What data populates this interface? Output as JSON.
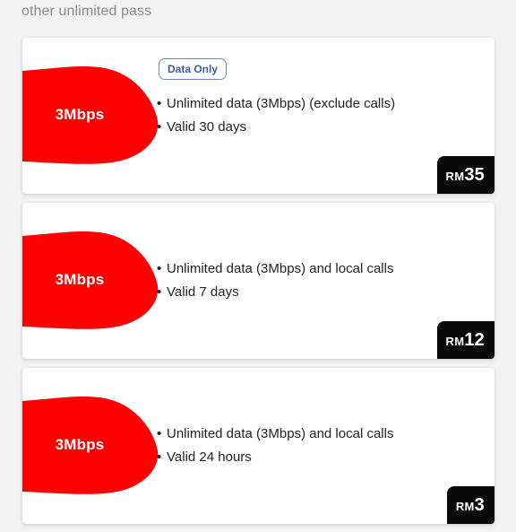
{
  "section_title": "other unlimited pass",
  "colors": {
    "brand_red": "#ff0000",
    "price_bg": "#0a0a0a",
    "badge_border": "#6f88c8"
  },
  "passes": [
    {
      "speed": "3Mbps",
      "badge": "Data Only",
      "features": [
        "Unlimited data (3Mbps) (exclude calls)",
        "Valid 30 days"
      ],
      "currency": "RM",
      "amount": "35"
    },
    {
      "speed": "3Mbps",
      "features": [
        "Unlimited data (3Mbps) and local calls",
        "Valid 7 days"
      ],
      "currency": "RM",
      "amount": "12"
    },
    {
      "speed": "3Mbps",
      "features": [
        "Unlimited data (3Mbps) and local calls",
        "Valid 24 hours"
      ],
      "currency": "RM",
      "amount": "3"
    }
  ]
}
